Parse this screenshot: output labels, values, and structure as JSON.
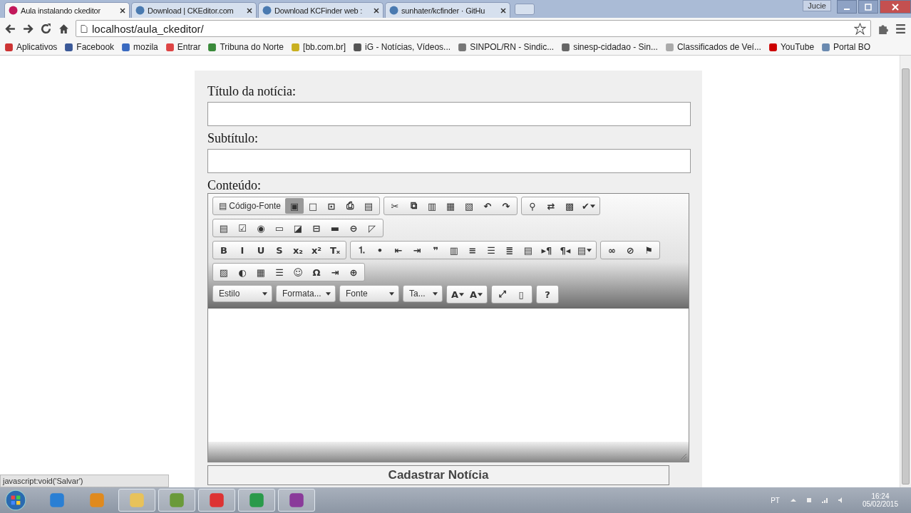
{
  "browser": {
    "user": "Jucie",
    "tabs": [
      {
        "title": "Aula instalando ckeditor",
        "selected": true
      },
      {
        "title": "Download | CKEditor.com",
        "selected": false
      },
      {
        "title": "Download KCFinder web :",
        "selected": false
      },
      {
        "title": "sunhater/kcfinder · GitHu",
        "selected": false
      }
    ],
    "address": "localhost/aula_ckeditor/",
    "bookmarks": [
      "Aplicativos",
      "Facebook",
      "mozila",
      "Entrar",
      "Tribuna do Norte",
      "[bb.com.br]",
      "iG - Notícias, Vídeos...",
      "SINPOL/RN - Sindic...",
      "sinesp-cidadao - Sin...",
      "Classificados de Veí...",
      "YouTube",
      "Portal BO"
    ]
  },
  "form": {
    "fields": [
      {
        "label": "Título da notícia:"
      },
      {
        "label": "Subtítulo:"
      }
    ],
    "content_label": "Conteúdo:",
    "editor": {
      "toolbar_rows": [
        {
          "groups": [
            {
              "buttons": [
                {
                  "kind": "labeled",
                  "glyph": "▤",
                  "label": "Código-Fonte",
                  "hovered": false
                },
                {
                  "kind": "icon",
                  "glyph": "▣",
                  "hovered": true
                },
                {
                  "kind": "icon",
                  "glyph": "□",
                  "hovered": false
                },
                {
                  "kind": "icon",
                  "glyph": "⊡",
                  "hovered": false
                },
                {
                  "kind": "icon",
                  "glyph": "⎙",
                  "hovered": false
                },
                {
                  "kind": "icon",
                  "glyph": "▤",
                  "hovered": false
                }
              ]
            },
            {
              "buttons": [
                {
                  "kind": "icon",
                  "glyph": "✂",
                  "hovered": false
                },
                {
                  "kind": "icon",
                  "glyph": "⧉",
                  "hovered": false
                },
                {
                  "kind": "icon",
                  "glyph": "▥",
                  "hovered": false
                },
                {
                  "kind": "icon",
                  "glyph": "▦",
                  "hovered": false
                },
                {
                  "kind": "icon",
                  "glyph": "▧",
                  "hovered": false
                },
                {
                  "kind": "icon",
                  "glyph": "↶",
                  "hovered": false
                },
                {
                  "kind": "icon",
                  "glyph": "↷",
                  "hovered": false
                }
              ]
            },
            {
              "buttons": [
                {
                  "kind": "icon",
                  "glyph": "⚲",
                  "hovered": false
                },
                {
                  "kind": "icon",
                  "glyph": "⇄",
                  "hovered": false
                },
                {
                  "kind": "icon",
                  "glyph": "▩",
                  "hovered": false
                },
                {
                  "kind": "dropdown",
                  "glyph": "✔",
                  "hovered": false
                }
              ]
            }
          ]
        },
        {
          "groups": [
            {
              "buttons": [
                {
                  "kind": "icon",
                  "glyph": "▤",
                  "hovered": false
                },
                {
                  "kind": "icon",
                  "glyph": "☑",
                  "hovered": false
                },
                {
                  "kind": "icon",
                  "glyph": "◉",
                  "hovered": false
                },
                {
                  "kind": "icon",
                  "glyph": "▭",
                  "hovered": false
                },
                {
                  "kind": "icon",
                  "glyph": "◪",
                  "hovered": false
                },
                {
                  "kind": "icon",
                  "glyph": "⊟",
                  "hovered": false
                },
                {
                  "kind": "icon",
                  "glyph": "▬",
                  "hovered": false
                },
                {
                  "kind": "icon",
                  "glyph": "⊖",
                  "hovered": false
                },
                {
                  "kind": "icon",
                  "glyph": "◸",
                  "hovered": false
                }
              ]
            }
          ]
        },
        {
          "groups": [
            {
              "buttons": [
                {
                  "kind": "icon",
                  "glyph": "B",
                  "hovered": false
                },
                {
                  "kind": "icon",
                  "glyph": "I",
                  "hovered": false
                },
                {
                  "kind": "icon",
                  "glyph": "U",
                  "hovered": false
                },
                {
                  "kind": "icon",
                  "glyph": "S",
                  "hovered": false
                },
                {
                  "kind": "icon",
                  "glyph": "x₂",
                  "hovered": false
                },
                {
                  "kind": "icon",
                  "glyph": "x²",
                  "hovered": false
                },
                {
                  "kind": "icon",
                  "glyph": "Tₓ",
                  "hovered": false
                }
              ]
            },
            {
              "buttons": [
                {
                  "kind": "icon",
                  "glyph": "⒈",
                  "hovered": false
                },
                {
                  "kind": "icon",
                  "glyph": "•",
                  "hovered": false
                },
                {
                  "kind": "icon",
                  "glyph": "⇤",
                  "hovered": false
                },
                {
                  "kind": "icon",
                  "glyph": "⇥",
                  "hovered": false
                },
                {
                  "kind": "icon",
                  "glyph": "❞",
                  "hovered": false
                },
                {
                  "kind": "icon",
                  "glyph": "▥",
                  "hovered": false
                },
                {
                  "kind": "icon",
                  "glyph": "≡",
                  "hovered": false
                },
                {
                  "kind": "icon",
                  "glyph": "☰",
                  "hovered": false
                },
                {
                  "kind": "icon",
                  "glyph": "≣",
                  "hovered": false
                },
                {
                  "kind": "icon",
                  "glyph": "▤",
                  "hovered": false
                },
                {
                  "kind": "icon",
                  "glyph": "▸¶",
                  "hovered": false
                },
                {
                  "kind": "icon",
                  "glyph": "¶◂",
                  "hovered": false
                },
                {
                  "kind": "dropdown",
                  "glyph": "▤",
                  "hovered": false
                }
              ]
            },
            {
              "buttons": [
                {
                  "kind": "icon",
                  "glyph": "∞",
                  "hovered": false
                },
                {
                  "kind": "icon",
                  "glyph": "⊘",
                  "hovered": false
                },
                {
                  "kind": "icon",
                  "glyph": "⚑",
                  "hovered": false
                }
              ]
            }
          ]
        },
        {
          "groups": [
            {
              "buttons": [
                {
                  "kind": "icon",
                  "glyph": "▨",
                  "hovered": false
                },
                {
                  "kind": "icon",
                  "glyph": "◐",
                  "hovered": false
                },
                {
                  "kind": "icon",
                  "glyph": "▦",
                  "hovered": false
                },
                {
                  "kind": "icon",
                  "glyph": "☰",
                  "hovered": false
                },
                {
                  "kind": "icon",
                  "glyph": "☺",
                  "hovered": false
                },
                {
                  "kind": "icon",
                  "glyph": "Ω",
                  "hovered": false
                },
                {
                  "kind": "icon",
                  "glyph": "⇥",
                  "hovered": false
                },
                {
                  "kind": "icon",
                  "glyph": "⊕",
                  "hovered": false
                }
              ]
            }
          ]
        },
        {
          "groups": [
            {
              "buttons": [
                {
                  "kind": "combo",
                  "label": "Estilo",
                  "hovered": false
                }
              ]
            },
            {
              "buttons": [
                {
                  "kind": "combo",
                  "label": "Formata...",
                  "hovered": false
                }
              ]
            },
            {
              "buttons": [
                {
                  "kind": "combo",
                  "label": "Fonte",
                  "hovered": false
                }
              ]
            },
            {
              "buttons": [
                {
                  "kind": "combo",
                  "label": "Ta...",
                  "hovered": false
                }
              ]
            },
            {
              "buttons": [
                {
                  "kind": "dropdown",
                  "glyph": "A",
                  "hovered": false
                },
                {
                  "kind": "dropdown",
                  "glyph": "A",
                  "hovered": false
                }
              ]
            },
            {
              "buttons": [
                {
                  "kind": "icon",
                  "glyph": "⤢",
                  "hovered": false
                },
                {
                  "kind": "icon",
                  "glyph": "▯",
                  "hovered": false
                }
              ]
            },
            {
              "buttons": [
                {
                  "kind": "icon",
                  "glyph": "?",
                  "hovered": false
                }
              ]
            }
          ]
        }
      ]
    },
    "submit": "Cadastrar Notícia"
  },
  "status": "javascript:void('Salvar')",
  "taskbar": {
    "tray_lang": "PT",
    "time": "16:24",
    "date": "05/02/2015"
  }
}
